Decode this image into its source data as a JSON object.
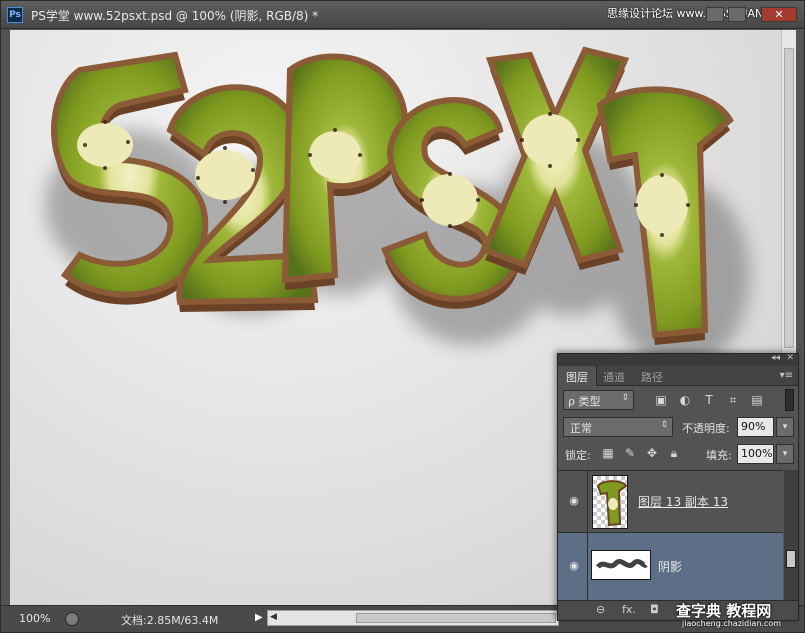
{
  "window": {
    "title": "PS学堂 www.52psxt.psd @ 100% (阴影, RGB/8) *",
    "app_logo": "Ps",
    "close_glyph": "✕",
    "watermark_top": "思缘设计论坛 www.MISSYUAN.COM"
  },
  "canvas": {
    "artwork_text": "52psxt",
    "background": "#e3e3e3"
  },
  "statusbar": {
    "zoom": "100%",
    "doc_size": "文档:2.85M/63.4M",
    "menu_arrow": "▶",
    "scroll_left": "◀"
  },
  "layers_panel": {
    "collapse_glyph": "◂◂",
    "close_glyph": "✕",
    "menu_glyph": "▾≡",
    "tabs": [
      {
        "label": "图层",
        "active": true
      },
      {
        "label": "通道",
        "active": false
      },
      {
        "label": "路径",
        "active": false
      }
    ],
    "filter": {
      "label": "ρ 类型",
      "arrow": "⇕"
    },
    "filter_icons": [
      "image-icon",
      "adjustment-icon",
      "type-icon",
      "shape-icon",
      "smart-object-icon"
    ],
    "blend_mode": {
      "value": "正常",
      "arrow": "⇕"
    },
    "opacity": {
      "label": "不透明度:",
      "value": "90%",
      "arrow": "▾"
    },
    "lock": {
      "label": "锁定:",
      "icons": [
        "lock-transparent-icon",
        "lock-paint-icon",
        "lock-move-icon",
        "lock-all-icon"
      ]
    },
    "fill": {
      "label": "填充:",
      "value": "100%",
      "arrow": "▾"
    },
    "layers": [
      {
        "name": "图层 13 副本 13",
        "visible": true,
        "selected": false
      },
      {
        "name": "阴影",
        "visible": true,
        "selected": true
      }
    ],
    "footer_icons": [
      "link-icon",
      "fx-icon",
      "mask-icon",
      "adjustment-layer-icon",
      "group-icon",
      "new-layer-icon",
      "delete-icon"
    ],
    "footer_labels": {
      "link": "⊖",
      "fx": "fx.",
      "mask": "◘"
    },
    "selected_color": "#5d6f86"
  },
  "watermark_bottom": {
    "main": "查字典 教程网",
    "sub": "jiaocheng.chazidian.com"
  },
  "colors": {
    "kiwi_flesh": "#7e9a1f",
    "kiwi_core": "#f1f0c2",
    "kiwi_skin": "#6b4226",
    "panel_bg": "#535353"
  }
}
